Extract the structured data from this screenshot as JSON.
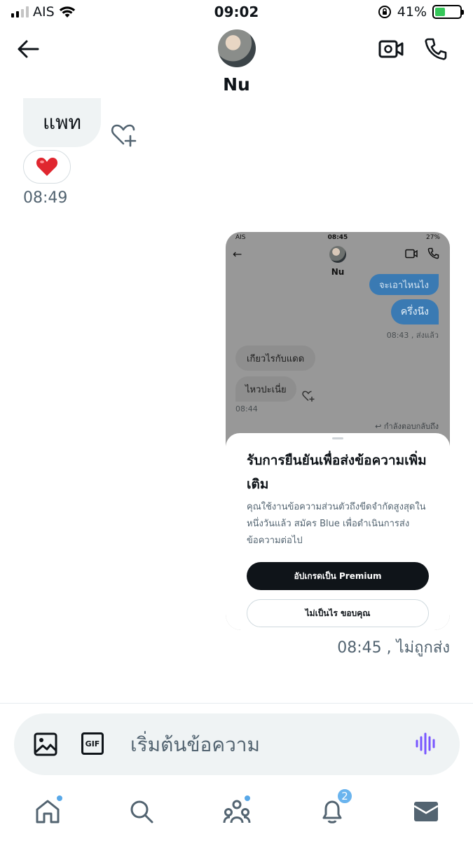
{
  "status_bar": {
    "carrier": "AIS",
    "time": "09:02",
    "battery_percent": "41%",
    "battery_level": 0.41,
    "battery_color": "#35c759"
  },
  "header": {
    "contact_name": "Nu",
    "icons": [
      "back-arrow-icon",
      "video-camera-icon",
      "phone-icon"
    ]
  },
  "received_message": {
    "text": "แพท",
    "reaction": "❤️",
    "time": "08:49"
  },
  "sent_attachment": {
    "embedded_screenshot": {
      "status_carrier": "AIS",
      "status_time": "08:45",
      "status_battery": "27%",
      "contact_name": "Nu",
      "outgoing_1": "จะเอาไหนไง",
      "outgoing_2": "ครึ่งนึง",
      "outgoing_time": "08:43 , ส่งแล้ว",
      "incoming_1": "เกียวไรกับแดด",
      "incoming_2": "ไหวปะเนี่ย",
      "incoming_time": "08:44",
      "replying_label": "กำลังตอบกลับถึง",
      "sheet_title": "รับการยืนยันเพื่อส่งข้อความเพิ่มเติม",
      "sheet_body": "คุณใช้งานข้อความส่วนตัวถึงขีดจำกัดสูงสุดในหนึ่งวันแล้ว สมัคร Blue เพื่อดำเนินการส่งข้อความต่อไป",
      "primary_button": "อัปเกรดเป็น Premium",
      "secondary_button": "ไม่เป็นไร ขอบคุณ"
    },
    "meta": "08:45 , ไม่ถูกส่ง"
  },
  "composer": {
    "placeholder": "เริ่มต้นข้อความ",
    "gif_label": "GIF",
    "accent": "#7856ff"
  },
  "tabbar": {
    "notifications_badge": "2",
    "accent_dot": "#58a8e8"
  }
}
